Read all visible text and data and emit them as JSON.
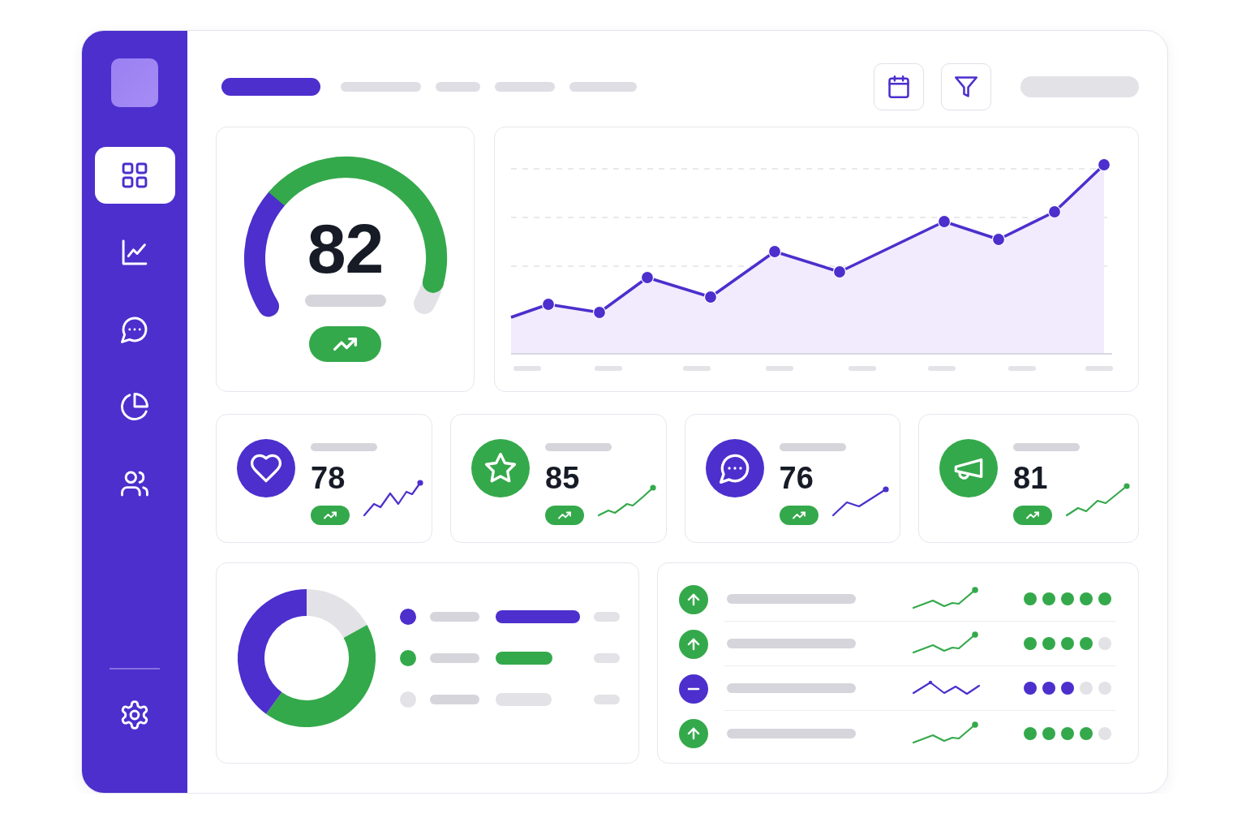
{
  "sidebar": {
    "items": [
      {
        "selected": true
      },
      {
        "selected": false
      },
      {
        "selected": false
      },
      {
        "selected": false
      },
      {
        "selected": false
      }
    ]
  },
  "tabs": [
    {
      "selected": true
    },
    {
      "selected": false
    },
    {
      "selected": false
    },
    {
      "selected": false
    },
    {
      "selected": false
    }
  ],
  "gauge": {
    "value": "82"
  },
  "stat_cards": [
    {
      "value": "78",
      "color": "#4c2fcd"
    },
    {
      "value": "85",
      "color": "#34a94b"
    },
    {
      "value": "76",
      "color": "#4c2fcd"
    },
    {
      "value": "81",
      "color": "#34a94b"
    }
  ],
  "legend": [
    {
      "color": "#4c2fcd"
    },
    {
      "color": "#34a94b"
    },
    {
      "color": "#e2e2e7"
    }
  ],
  "list": {
    "rows": [
      {
        "kind": "up",
        "color": "#34a94b",
        "stars": 5
      },
      {
        "kind": "up",
        "color": "#34a94b",
        "stars": 4
      },
      {
        "kind": "flat",
        "color": "#4c2fcd",
        "stars": 3
      },
      {
        "kind": "up",
        "color": "#34a94b",
        "stars": 4
      }
    ]
  }
}
